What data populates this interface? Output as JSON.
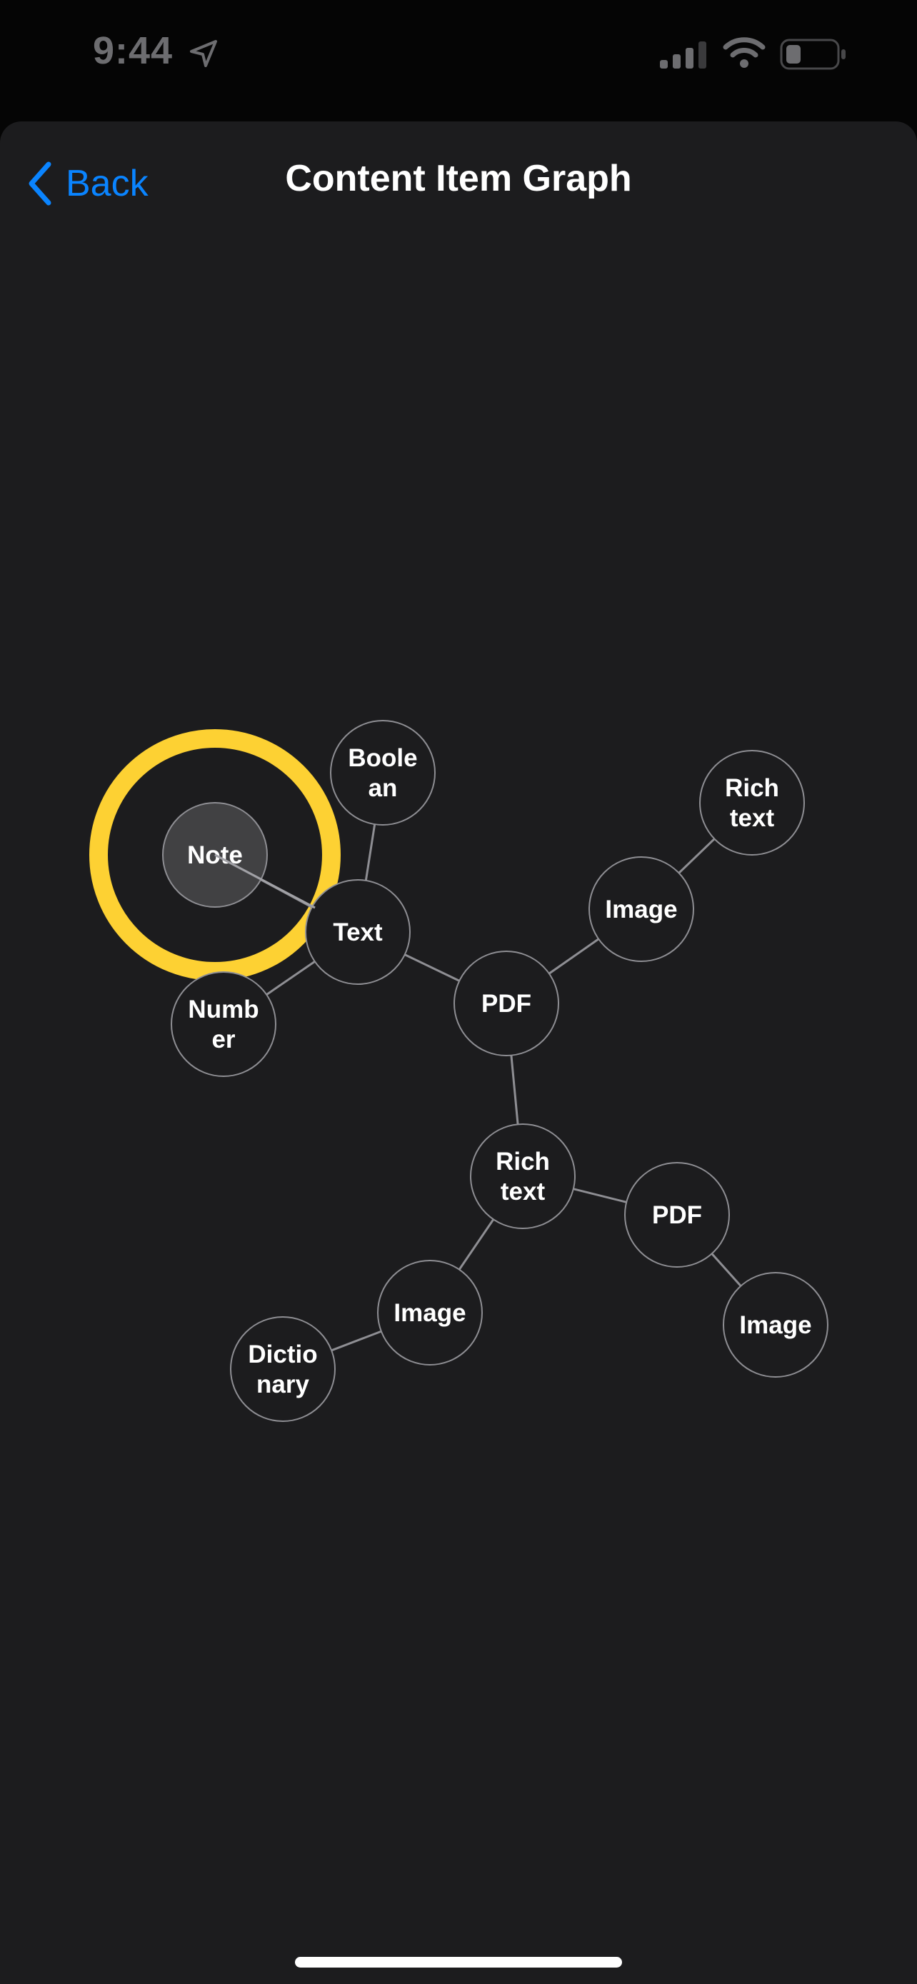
{
  "status_bar": {
    "time": "9:44",
    "icons": [
      "location-arrow-icon",
      "cellular-signal-icon",
      "wifi-icon",
      "battery-icon"
    ]
  },
  "nav": {
    "back_label": "Back",
    "back_icon": "chevron-left-icon",
    "title": "Content Item Graph"
  },
  "colors": {
    "accent": "#0a84ff",
    "highlight_ring": "#fdd133",
    "background": "#1c1c1e",
    "node_fill": "#1c1c1e",
    "selected_node_fill": "#48484a",
    "edge": "#8e8e93"
  },
  "graph": {
    "selected_node": "note",
    "nodes": [
      {
        "id": "note",
        "lines": [
          "Note"
        ]
      },
      {
        "id": "boolean",
        "lines": [
          "Boole",
          "an"
        ]
      },
      {
        "id": "text",
        "lines": [
          "Text"
        ]
      },
      {
        "id": "number",
        "lines": [
          "Numb",
          "er"
        ]
      },
      {
        "id": "pdf-1",
        "lines": [
          "PDF"
        ]
      },
      {
        "id": "image-1",
        "lines": [
          "Image"
        ]
      },
      {
        "id": "rich-text-1",
        "lines": [
          "Rich",
          "text"
        ]
      },
      {
        "id": "rich-text-2",
        "lines": [
          "Rich",
          "text"
        ]
      },
      {
        "id": "pdf-2",
        "lines": [
          "PDF"
        ]
      },
      {
        "id": "image-2",
        "lines": [
          "Image"
        ]
      },
      {
        "id": "image-3",
        "lines": [
          "Image"
        ]
      },
      {
        "id": "dictionary",
        "lines": [
          "Dictio",
          "nary"
        ]
      }
    ],
    "edges": [
      [
        "note",
        "text"
      ],
      [
        "boolean",
        "text"
      ],
      [
        "number",
        "text"
      ],
      [
        "text",
        "pdf-1"
      ],
      [
        "pdf-1",
        "image-1"
      ],
      [
        "image-1",
        "rich-text-1"
      ],
      [
        "pdf-1",
        "rich-text-2"
      ],
      [
        "rich-text-2",
        "pdf-2"
      ],
      [
        "pdf-2",
        "image-2"
      ],
      [
        "rich-text-2",
        "image-3"
      ],
      [
        "image-3",
        "dictionary"
      ]
    ]
  }
}
